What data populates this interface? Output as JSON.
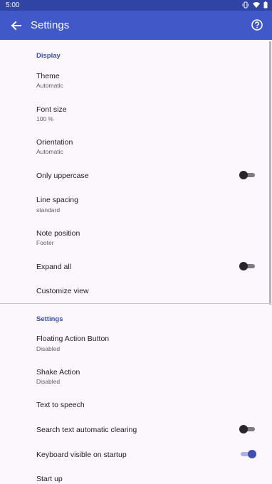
{
  "status_bar": {
    "time": "5:00"
  },
  "app_bar": {
    "title": "Settings"
  },
  "sections": {
    "display": "Display",
    "settings": "Settings"
  },
  "prefs": {
    "theme": {
      "title": "Theme",
      "summary": "Automatic"
    },
    "font_size": {
      "title": "Font size",
      "summary": "100 %"
    },
    "orientation": {
      "title": "Orientation",
      "summary": "Automatic"
    },
    "only_uppercase": {
      "title": "Only uppercase",
      "enabled": false
    },
    "line_spacing": {
      "title": "Line spacing",
      "summary": "standard"
    },
    "note_position": {
      "title": "Note position",
      "summary": "Footer"
    },
    "expand_all": {
      "title": "Expand all",
      "enabled": false
    },
    "customize_view": {
      "title": "Customize view"
    },
    "fab": {
      "title": "Floating Action Button",
      "summary": "Disabled"
    },
    "shake_action": {
      "title": "Shake Action",
      "summary": "Disabled"
    },
    "text_to_speech": {
      "title": "Text to speech"
    },
    "search_clearing": {
      "title": "Search text automatic clearing",
      "enabled": false
    },
    "keyboard_visible": {
      "title": "Keyboard visible on startup",
      "enabled": true
    },
    "start_up": {
      "title": "Start up"
    }
  },
  "colors": {
    "app_bar": "#4158c9",
    "status_bar": "#2f44a5",
    "accent": "#3d4fb0",
    "background": "#fcf7fd"
  }
}
